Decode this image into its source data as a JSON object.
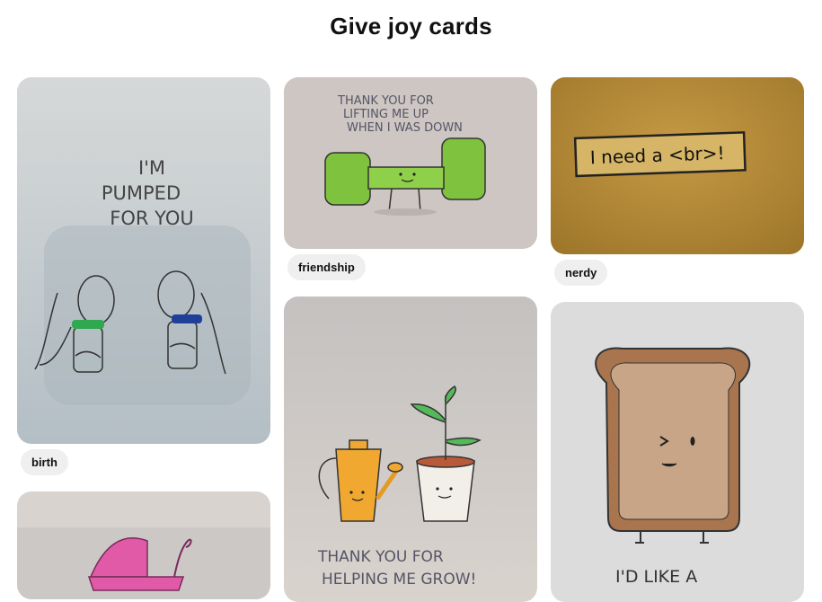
{
  "page": {
    "title": "Give joy cards"
  },
  "cards": [
    {
      "name": "pumped",
      "text_lines": [
        "I'M",
        "PUMPED",
        "FOR YOU"
      ],
      "tag": "birth"
    },
    {
      "name": "lifting",
      "text_lines": [
        "THANK YOU FOR",
        "LIFTING ME UP",
        "WHEN I WAS DOWN"
      ],
      "tag": "friendship"
    },
    {
      "name": "br",
      "text_lines": [
        "I need a <br>!"
      ],
      "tag": "nerdy"
    },
    {
      "name": "grow",
      "text_lines": [
        "THANK YOU FOR",
        "HELPING ME GROW!"
      ]
    },
    {
      "name": "toast",
      "text_lines": [
        "I'D LIKE A"
      ]
    },
    {
      "name": "stroller",
      "text_lines": []
    }
  ]
}
